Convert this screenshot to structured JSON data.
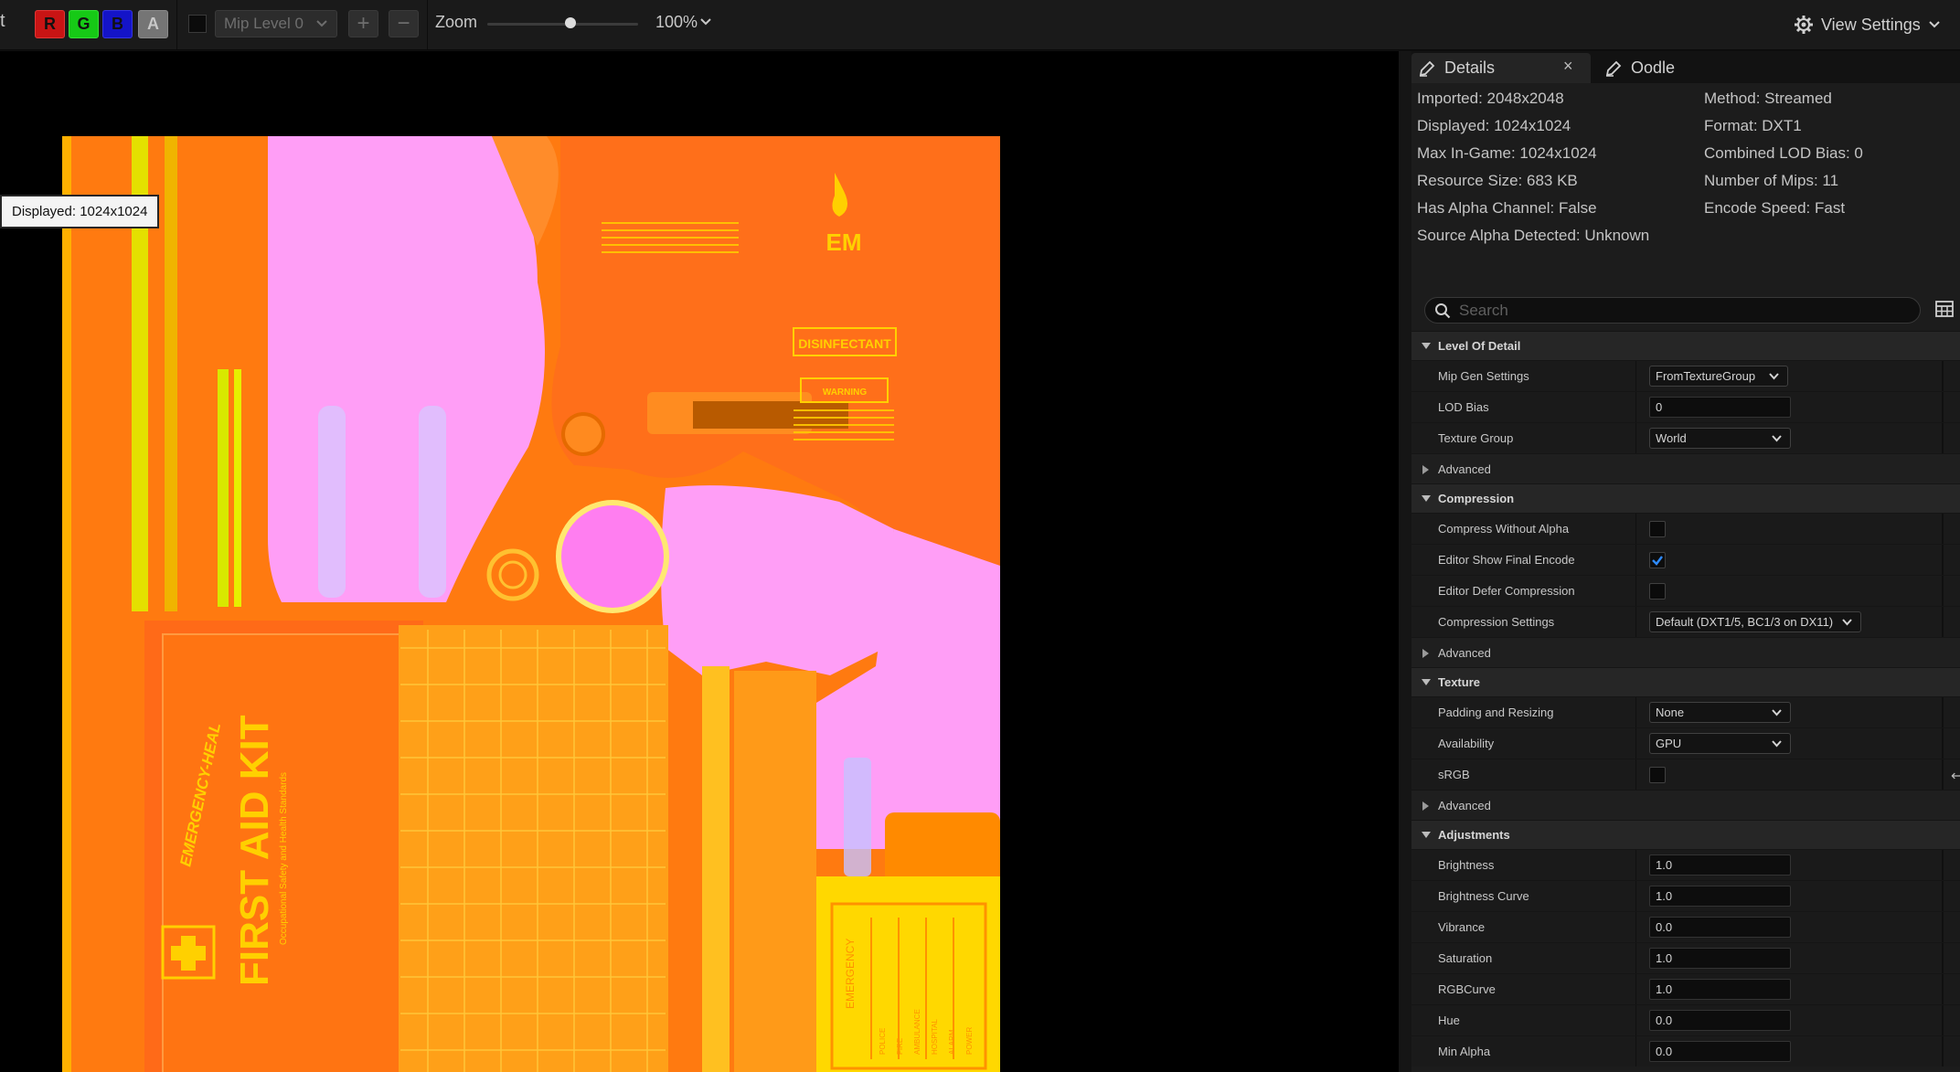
{
  "toolbar": {
    "cut_text": "t",
    "channels": {
      "r": "R",
      "g": "G",
      "b": "B",
      "a": "A"
    },
    "mip_level": "Mip Level 0",
    "zoom_label": "Zoom",
    "zoom_value": "100%",
    "zoom_level": 0.55,
    "view_settings": "View Settings"
  },
  "viewport": {
    "tooltip": "Displayed: 1024x1024",
    "texture": {
      "em_text": "EM",
      "disinfectant": "DISINFECTANT",
      "warning": "WARNING",
      "first_aid": "FIRST AID KIT",
      "brand": "EMERGENCY-HEAL",
      "standards": "Occupational Safety and Health Standards",
      "emergency": "EMERGENCY",
      "emergency_items": [
        "POLICE",
        "FIRE",
        "AMBULANCE",
        "HOSPITAL",
        "ALARM",
        "POWER"
      ]
    }
  },
  "panel": {
    "tabs": {
      "details": "Details",
      "close": "×",
      "oodle": "Oodle"
    },
    "info_left": [
      "Imported: 2048x2048",
      "Displayed: 1024x1024",
      "Max In-Game: 1024x1024",
      "Resource Size: 683 KB",
      "Has Alpha Channel: False",
      "Source Alpha Detected: Unknown"
    ],
    "info_right": [
      "Method: Streamed",
      "Format: DXT1",
      "Combined LOD Bias: 0",
      "Number of Mips: 11",
      "Encode Speed: Fast"
    ],
    "search_placeholder": "Search",
    "sections": {
      "lod": {
        "title": "Level Of Detail",
        "mip_gen": {
          "label": "Mip Gen Settings",
          "value": "FromTextureGroup"
        },
        "lod_bias": {
          "label": "LOD Bias",
          "value": "0"
        },
        "texture_group": {
          "label": "Texture Group",
          "value": "World"
        },
        "advanced": "Advanced"
      },
      "compression": {
        "title": "Compression",
        "without_alpha": {
          "label": "Compress Without Alpha",
          "checked": false
        },
        "show_final": {
          "label": "Editor Show Final Encode",
          "checked": true
        },
        "defer": {
          "label": "Editor Defer Compression",
          "checked": false
        },
        "settings": {
          "label": "Compression Settings",
          "value": "Default (DXT1/5, BC1/3 on DX11)"
        },
        "advanced": "Advanced"
      },
      "texture": {
        "title": "Texture",
        "padding": {
          "label": "Padding and Resizing",
          "value": "None"
        },
        "availability": {
          "label": "Availability",
          "value": "GPU"
        },
        "srgb": {
          "label": "sRGB",
          "checked": false
        },
        "reset": "↩",
        "advanced": "Advanced"
      },
      "adjustments": {
        "title": "Adjustments",
        "rows": [
          {
            "label": "Brightness",
            "value": "1.0"
          },
          {
            "label": "Brightness Curve",
            "value": "1.0"
          },
          {
            "label": "Vibrance",
            "value": "0.0"
          },
          {
            "label": "Saturation",
            "value": "1.0"
          },
          {
            "label": "RGBCurve",
            "value": "1.0"
          },
          {
            "label": "Hue",
            "value": "0.0"
          },
          {
            "label": "Min Alpha",
            "value": "0.0"
          }
        ]
      }
    }
  }
}
